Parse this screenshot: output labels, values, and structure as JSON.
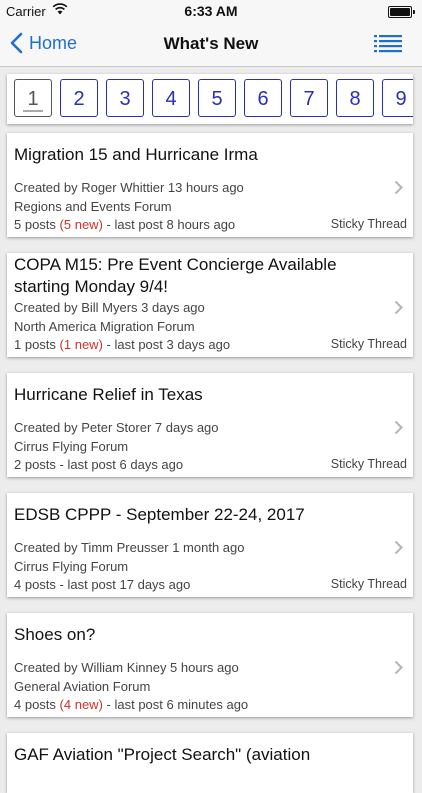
{
  "status": {
    "carrier": "Carrier",
    "time": "6:33 AM"
  },
  "nav": {
    "back_label": "Home",
    "title": "What's New"
  },
  "pager": {
    "pages": [
      "1",
      "2",
      "3",
      "4",
      "5",
      "6",
      "7",
      "8",
      "9"
    ],
    "current": "1"
  },
  "threads": [
    {
      "title": "Migration 15 and Hurricane Irma",
      "created": "Created by Roger Whittier 13 hours ago",
      "forum": "Regions and Events Forum",
      "posts": "5 posts",
      "new": "(5 new)",
      "last": "- last post 8 hours ago",
      "sticky": "Sticky Thread"
    },
    {
      "title": "COPA M15: Pre Event Concierge Available starting Monday 9/4!",
      "created": "Created by Bill Myers 3 days ago",
      "forum": "North America Migration Forum",
      "posts": "1 posts",
      "new": "(1 new)",
      "last": "- last post 3 days ago",
      "sticky": "Sticky Thread"
    },
    {
      "title": "Hurricane Relief in Texas",
      "created": "Created by Peter Storer 7 days ago",
      "forum": "Cirrus Flying Forum",
      "posts": "2 posts",
      "new": "",
      "last": "- last post 6 days ago",
      "sticky": "Sticky Thread"
    },
    {
      "title": "EDSB CPPP - September 22-24, 2017",
      "created": "Created by Timm Preusser 1 month ago",
      "forum": "Cirrus Flying Forum",
      "posts": "4 posts",
      "new": "",
      "last": "- last post 17 days ago",
      "sticky": "Sticky Thread"
    },
    {
      "title": "Shoes on?",
      "created": "Created by William Kinney 5 hours ago",
      "forum": "General Aviation Forum",
      "posts": "4 posts",
      "new": "(4 new)",
      "last": "- last post 6 minutes ago",
      "sticky": ""
    },
    {
      "title": "GAF Aviation \"Project Search\" (aviation",
      "created": "",
      "forum": "",
      "posts": "",
      "new": "",
      "last": "",
      "sticky": ""
    }
  ],
  "icons": {
    "back": "chevron-left-icon",
    "menu": "list-menu-icon",
    "row": "chevron-right-icon",
    "wifi": "wifi-icon",
    "battery": "battery-icon"
  },
  "colors": {
    "accent": "#1f6fd1",
    "pager": "#2a2fb5",
    "new": "#d0312d"
  }
}
